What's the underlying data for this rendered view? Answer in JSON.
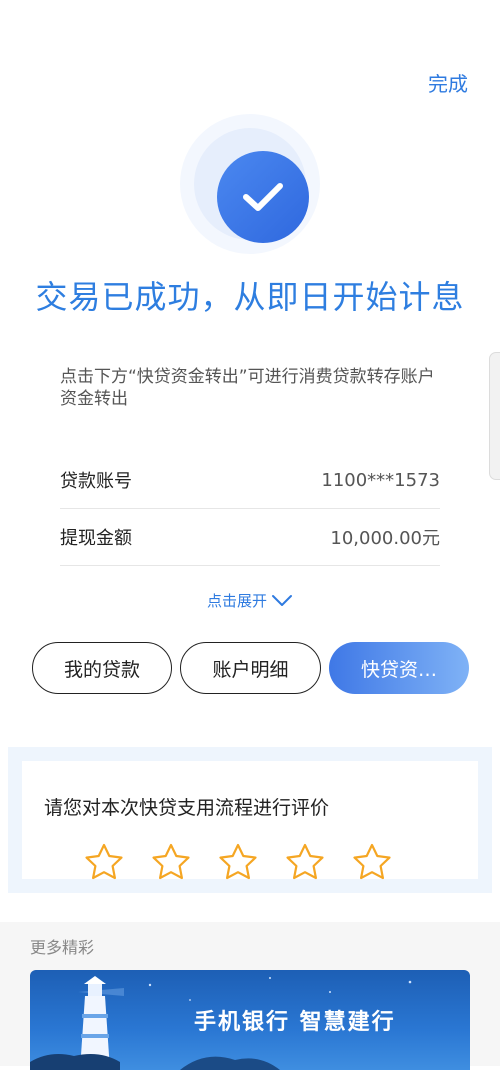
{
  "header": {
    "done_label": "完成"
  },
  "status": {
    "headline": "交易已成功，从即日开始计息",
    "hint": "点击下方“快贷资金转出”可进行消费贷款转存账户资金转出"
  },
  "details": [
    {
      "label": "贷款账号",
      "value": "1100***1573"
    },
    {
      "label": "提现金额",
      "value": "10,000.00元"
    }
  ],
  "expand_label": "点击展开",
  "actions": {
    "my_loans": "我的贷款",
    "account_details": "账户明细",
    "transfer": "快贷资…"
  },
  "rating": {
    "title": "请您对本次快贷支用流程进行评价",
    "stars": 5,
    "selected": 0,
    "star_color": "#f5a623"
  },
  "more": {
    "title": "更多精彩",
    "banner_text": "手机银行  智慧建行"
  },
  "colors": {
    "accent": "#2f7be0",
    "primary_button": "#3f78e6"
  }
}
